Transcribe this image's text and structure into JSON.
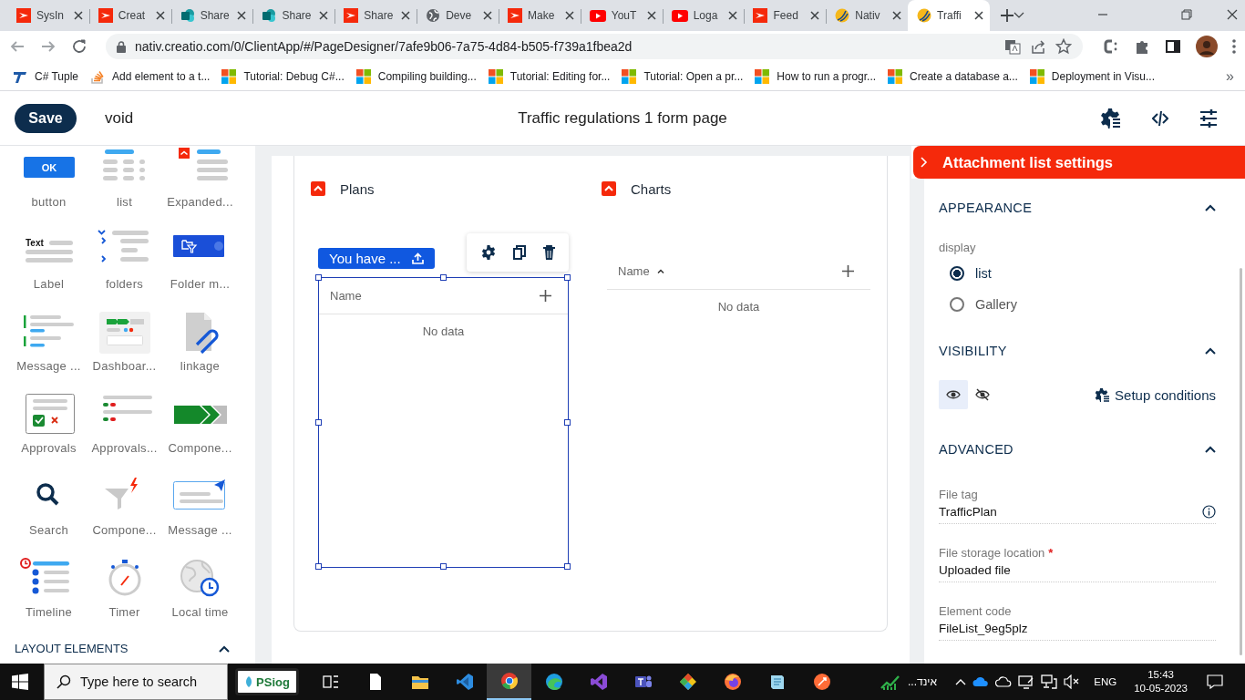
{
  "browser": {
    "tabs": [
      {
        "title": "SysIn",
        "kind": "creatio",
        "selected": false
      },
      {
        "title": "Creat",
        "kind": "creatio",
        "selected": false
      },
      {
        "title": "Share",
        "kind": "sharepoint",
        "selected": false
      },
      {
        "title": "Share",
        "kind": "sharepoint",
        "selected": false
      },
      {
        "title": "Share",
        "kind": "creatio",
        "selected": false
      },
      {
        "title": "Deve",
        "kind": "globe",
        "selected": false
      },
      {
        "title": "Make",
        "kind": "creatio",
        "selected": false
      },
      {
        "title": "YouT",
        "kind": "youtube",
        "selected": false
      },
      {
        "title": "Loga",
        "kind": "youtube",
        "selected": false
      },
      {
        "title": "Feed",
        "kind": "creatio",
        "selected": false
      },
      {
        "title": "Nativ",
        "kind": "nativ",
        "selected": false
      },
      {
        "title": "Traffi",
        "kind": "nativ",
        "selected": true
      }
    ],
    "address": "nativ.creatio.com/0/ClientApp/#/PageDesigner/7afe9b06-7a75-4d84-b505-f739a1fbea2d",
    "bookmarks": [
      {
        "title": "C# Tuple",
        "kind": "tuple"
      },
      {
        "title": "Add element to a t...",
        "kind": "stack"
      },
      {
        "title": "Tutorial: Debug C#...",
        "kind": "windows"
      },
      {
        "title": "Compiling building...",
        "kind": "windows"
      },
      {
        "title": "Tutorial: Editing for...",
        "kind": "windows"
      },
      {
        "title": "Tutorial: Open a pr...",
        "kind": "windows"
      },
      {
        "title": "How to run a progr...",
        "kind": "windows"
      },
      {
        "title": "Create a database a...",
        "kind": "windows"
      },
      {
        "title": "Deployment in Visu...",
        "kind": "windows"
      }
    ],
    "bookmarks_more": "»"
  },
  "app": {
    "save": "Save",
    "page_name": "void",
    "title": "Traffic regulations 1 form page"
  },
  "palette": {
    "items": [
      {
        "label": "button",
        "kind": "button",
        "icon_text": "OK"
      },
      {
        "label": "list",
        "kind": "list"
      },
      {
        "label": "Expanded...",
        "kind": "expanded-list"
      },
      {
        "label": "Label",
        "kind": "label",
        "icon_text": "Text"
      },
      {
        "label": "folders",
        "kind": "folders"
      },
      {
        "label": "Folder m...",
        "kind": "folder-manager"
      },
      {
        "label": "Message ...",
        "kind": "message-list"
      },
      {
        "label": "Dashboar...",
        "kind": "dashboard"
      },
      {
        "label": "linkage",
        "kind": "attachment"
      },
      {
        "label": "Approvals",
        "kind": "approvals"
      },
      {
        "label": "Approvals...",
        "kind": "approvals-list"
      },
      {
        "label": "Compone...",
        "kind": "progress"
      },
      {
        "label": "Search",
        "kind": "search"
      },
      {
        "label": "Compone...",
        "kind": "filter"
      },
      {
        "label": "Message ...",
        "kind": "composer"
      },
      {
        "label": "Timeline",
        "kind": "timeline"
      },
      {
        "label": "Timer",
        "kind": "timer"
      },
      {
        "label": "Local time",
        "kind": "local-time"
      }
    ],
    "section_heading": "LAYOUT ELEMENTS"
  },
  "canvas": {
    "sections": [
      {
        "title": "Plans",
        "expanded": true,
        "upload_button": "You have ...",
        "selected": true,
        "table": {
          "column": "Name",
          "sorted": false,
          "empty": "No data"
        }
      },
      {
        "title": "Charts",
        "expanded": true,
        "selected": false,
        "table": {
          "column": "Name",
          "sorted": true,
          "empty": "No data"
        }
      }
    ]
  },
  "settings": {
    "title": "Attachment list settings",
    "appearance": {
      "heading": "APPEARANCE",
      "expanded": true,
      "label": "display",
      "options": [
        {
          "label": "list",
          "selected": true
        },
        {
          "label": "Gallery",
          "selected": false
        }
      ]
    },
    "visibility": {
      "heading": "VISIBILITY",
      "expanded": true,
      "visible": true,
      "conditions": "Setup conditions"
    },
    "advanced": {
      "heading": "ADVANCED",
      "expanded": true,
      "fields": [
        {
          "label": "File tag",
          "value": "TrafficPlan",
          "info": true
        },
        {
          "label": "File storage location",
          "mark": "*",
          "value": "Uploaded file",
          "info": false
        },
        {
          "label": "Element code",
          "value": "FileList_9eg5plz",
          "info": false
        }
      ]
    }
  },
  "taskbar": {
    "search_placeholder": "Type here to search",
    "logo": "PSiog",
    "apps": [
      {
        "kind": "task-view",
        "active": false
      },
      {
        "kind": "file",
        "active": false
      },
      {
        "kind": "folder",
        "active": false
      },
      {
        "kind": "vscode",
        "active": false
      },
      {
        "kind": "chrome",
        "active": true
      },
      {
        "kind": "edge",
        "active": false
      },
      {
        "kind": "visual-studio",
        "active": false
      },
      {
        "kind": "teams",
        "active": false
      },
      {
        "kind": "git",
        "active": false
      },
      {
        "kind": "firefox",
        "active": false
      },
      {
        "kind": "notepad",
        "active": false
      },
      {
        "kind": "postman",
        "active": false
      }
    ],
    "stock": "אינד...",
    "language": "ENG",
    "time": "15:43",
    "date": "10-05-2023"
  }
}
